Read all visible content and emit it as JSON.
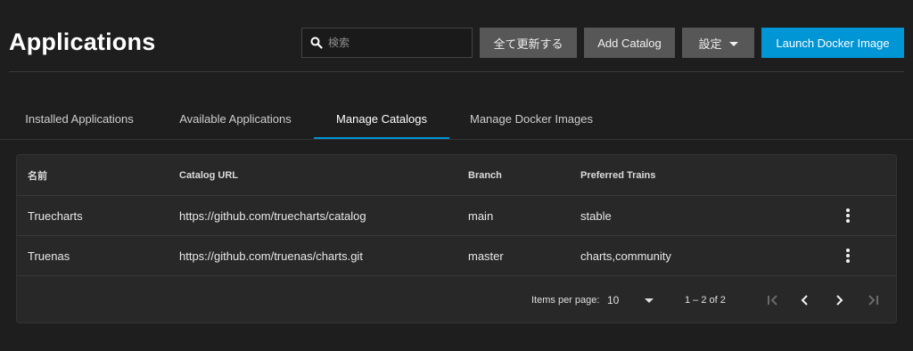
{
  "header": {
    "title": "Applications",
    "search_placeholder": "検索",
    "refresh_all_label": "全て更新する",
    "add_catalog_label": "Add Catalog",
    "settings_label": "設定",
    "launch_docker_label": "Launch Docker Image"
  },
  "tabs": [
    {
      "label": "Installed Applications",
      "active": false
    },
    {
      "label": "Available Applications",
      "active": false
    },
    {
      "label": "Manage Catalogs",
      "active": true
    },
    {
      "label": "Manage Docker Images",
      "active": false
    }
  ],
  "table": {
    "columns": [
      "名前",
      "Catalog URL",
      "Branch",
      "Preferred Trains"
    ],
    "rows": [
      {
        "name": "Truecharts",
        "url": "https://github.com/truecharts/catalog",
        "branch": "main",
        "trains": "stable"
      },
      {
        "name": "Truenas",
        "url": "https://github.com/truenas/charts.git",
        "branch": "master",
        "trains": "charts,community"
      }
    ]
  },
  "paginator": {
    "items_per_page_label": "Items per page:",
    "page_size": "10",
    "range_label": "1 – 2 of 2"
  },
  "colors": {
    "background": "#1e1e1e",
    "accent": "#0095d5",
    "button": "#575757",
    "card": "#282828"
  },
  "icons": [
    "search-icon",
    "chevron-down-icon",
    "more-vert-icon",
    "first-page-icon",
    "chevron-left-icon",
    "chevron-right-icon",
    "last-page-icon"
  ]
}
